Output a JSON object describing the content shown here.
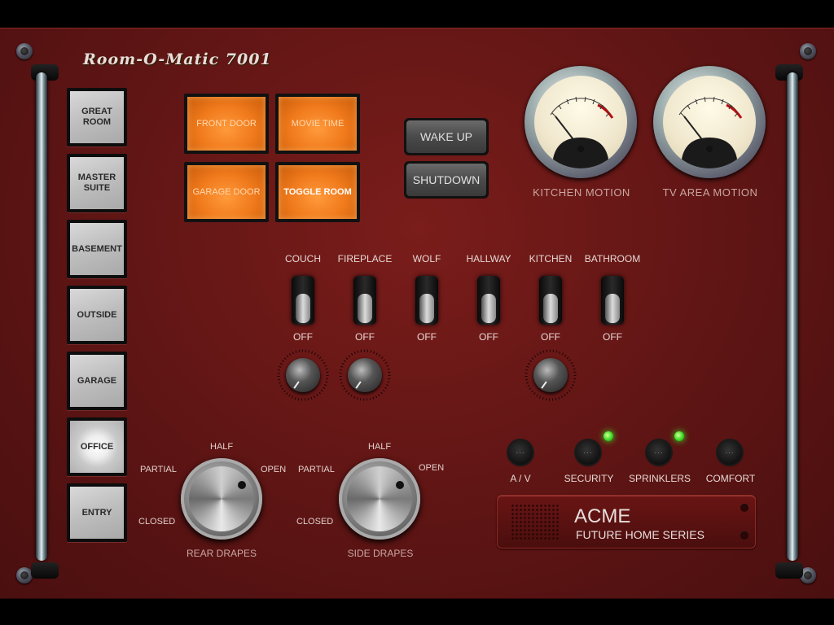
{
  "app": {
    "title": "Room-O-Matic 7001"
  },
  "rooms": [
    {
      "label": "GREAT\nROOM",
      "selected": false
    },
    {
      "label": "MASTER\nSUITE",
      "selected": false
    },
    {
      "label": "BASEMENT",
      "selected": false
    },
    {
      "label": "OUTSIDE",
      "selected": false
    },
    {
      "label": "GARAGE",
      "selected": false
    },
    {
      "label": "OFFICE",
      "selected": true
    },
    {
      "label": "ENTRY",
      "selected": false
    }
  ],
  "scenes": [
    {
      "label": "FRONT DOOR"
    },
    {
      "label": "MOVIE TIME"
    },
    {
      "label": "GARAGE DOOR"
    },
    {
      "label": "TOGGLE ROOM"
    }
  ],
  "system": {
    "wake_label": "WAKE UP",
    "shutdown_label": "SHUTDOWN"
  },
  "gauges": [
    {
      "label": "KITCHEN MOTION"
    },
    {
      "label": "TV AREA MOTION"
    }
  ],
  "switches": [
    {
      "label": "COUCH",
      "state": "OFF"
    },
    {
      "label": "FIREPLACE",
      "state": "OFF"
    },
    {
      "label": "WOLF",
      "state": "OFF"
    },
    {
      "label": "HALLWAY",
      "state": "OFF"
    },
    {
      "label": "KITCHEN",
      "state": "OFF"
    },
    {
      "label": "BATHROOM",
      "state": "OFF"
    }
  ],
  "drapes": [
    {
      "title": "REAR DRAPES",
      "closed": "CLOSED",
      "partial": "PARTIAL",
      "half": "HALF",
      "open": "OPEN"
    },
    {
      "title": "SIDE DRAPES",
      "closed": "CLOSED",
      "partial": "PARTIAL",
      "half": "HALF",
      "open": "OPEN"
    }
  ],
  "controls": [
    {
      "label": "A / V",
      "led": false
    },
    {
      "label": "SECURITY",
      "led": true
    },
    {
      "label": "SPRINKLERS",
      "led": true
    },
    {
      "label": "COMFORT",
      "led": false
    }
  ],
  "brand": {
    "name": "ACME",
    "series": "FUTURE HOME SERIES"
  },
  "colors": {
    "panel": "#5e1514",
    "scene": "#f07a1c",
    "led": "#45e02a"
  }
}
